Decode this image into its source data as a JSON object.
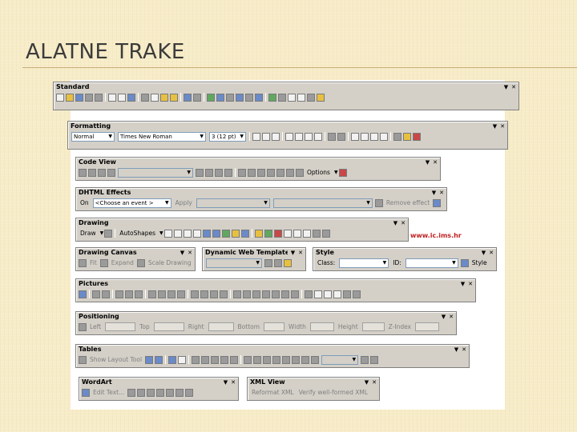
{
  "slide": {
    "title": "ALATNE TRAKE"
  },
  "watermark": "www.ic.ims.hr",
  "toolbars": {
    "standard": {
      "title": "Standard"
    },
    "formatting": {
      "title": "Formatting",
      "style": "Normal",
      "font": "Times New Roman",
      "size": "3 (12 pt)"
    },
    "code_view": {
      "title": "Code View",
      "options": "Options"
    },
    "dhtml": {
      "title": "DHTML Effects",
      "on": "On",
      "event": "<Choose an event >",
      "apply": "Apply",
      "remove": "Remove effect"
    },
    "drawing": {
      "title": "Drawing",
      "draw": "Draw",
      "autoshapes": "AutoShapes"
    },
    "drawing_canvas": {
      "title": "Drawing Canvas",
      "fit": "Fit",
      "expand": "Expand",
      "scale": "Scale Drawing"
    },
    "dwt": {
      "title": "Dynamic Web Template"
    },
    "style": {
      "title": "Style",
      "class": "Class:",
      "id": "ID:",
      "style_btn": "Style"
    },
    "pictures": {
      "title": "Pictures"
    },
    "positioning": {
      "title": "Positioning",
      "left": "Left",
      "top": "Top",
      "right": "Right",
      "bottom": "Bottom",
      "width": "Width",
      "height": "Height",
      "zindex": "Z-Index"
    },
    "tables": {
      "title": "Tables",
      "show_layout": "Show Layout Tool"
    },
    "wordart": {
      "title": "WordArt",
      "edit": "Edit Text..."
    },
    "xml_view": {
      "title": "XML View",
      "reformat": "Reformat XML",
      "verify": "Verify well-formed XML"
    }
  }
}
